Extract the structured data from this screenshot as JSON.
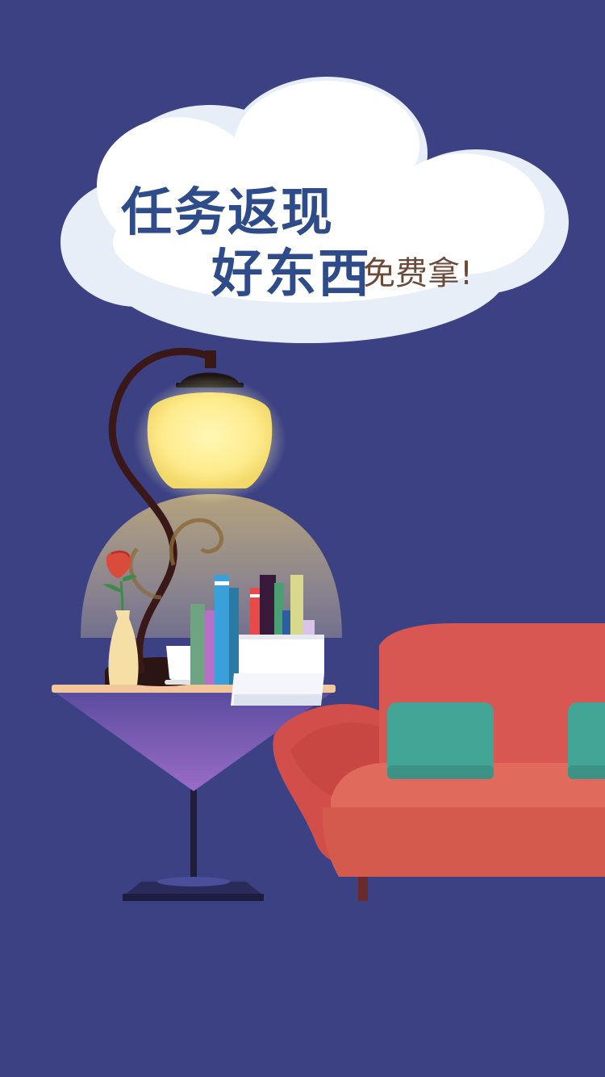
{
  "background_color": "#3B4183",
  "cloud": {
    "headline": "任务返现",
    "subheadline": "好东西",
    "tagline": "免费拿!",
    "headline_color": "#2E4B8A",
    "tagline_color": "#6B4A3A"
  },
  "illustration": {
    "lamp_icon": "desk-lamp-icon",
    "table_icon": "side-table-icon",
    "sofa_icon": "sofa-icon",
    "flower_icon": "rose-vase-icon",
    "cup_icon": "coffee-cup-icon",
    "books_icon": "books-icon",
    "papers_icon": "paper-stack-icon"
  }
}
